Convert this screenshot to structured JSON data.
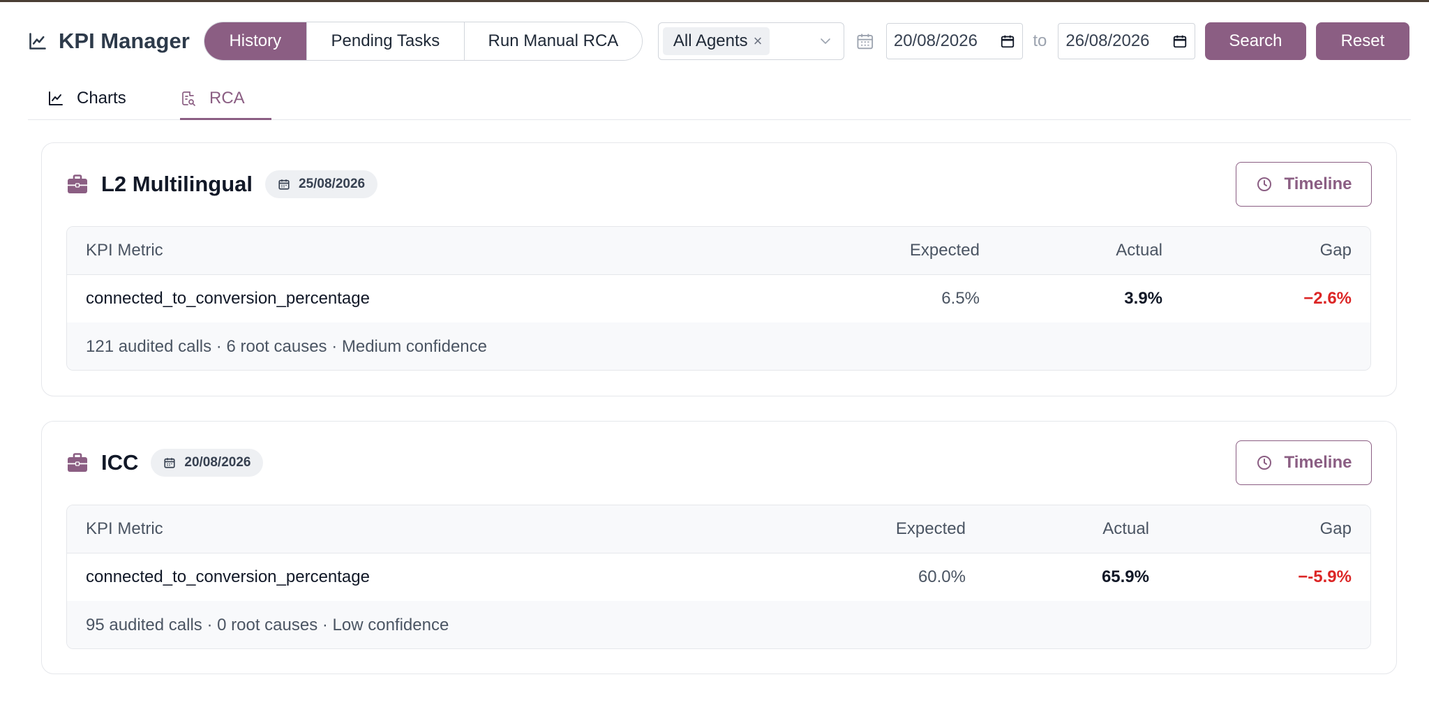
{
  "app": {
    "title": "KPI Manager"
  },
  "nav": {
    "segments": [
      {
        "label": "History",
        "active": true
      },
      {
        "label": "Pending Tasks",
        "active": false
      },
      {
        "label": "Run Manual RCA",
        "active": false
      }
    ]
  },
  "filters": {
    "agent_tag": "All Agents",
    "date_from": "20/08/2026",
    "to_label": "to",
    "date_to": "26/08/2026",
    "search_label": "Search",
    "reset_label": "Reset"
  },
  "tabs": [
    {
      "label": "Charts",
      "active": false
    },
    {
      "label": "RCA",
      "active": true
    }
  ],
  "table_headers": {
    "metric": "KPI Metric",
    "expected": "Expected",
    "actual": "Actual",
    "gap": "Gap"
  },
  "cards": [
    {
      "title": "L2 Multilingual",
      "date": "25/08/2026",
      "timeline_label": "Timeline",
      "row": {
        "metric": "connected_to_conversion_percentage",
        "expected": "6.5%",
        "actual": "3.9%",
        "gap": "−2.6%"
      },
      "summary": "121 audited calls · 6 root causes · Medium confidence"
    },
    {
      "title": "ICC",
      "date": "20/08/2026",
      "timeline_label": "Timeline",
      "row": {
        "metric": "connected_to_conversion_percentage",
        "expected": "60.0%",
        "actual": "65.9%",
        "gap": "−-5.9%"
      },
      "summary": "95 audited calls · 0 root causes · Low confidence"
    }
  ],
  "colors": {
    "accent": "#8b5e83",
    "gap_negative": "#dc2626",
    "border": "#e5e7eb"
  },
  "icons": {
    "brand": "line-chart-icon",
    "card": "briefcase-icon",
    "timeline": "clock-icon",
    "calendar": "calendar-icon"
  }
}
